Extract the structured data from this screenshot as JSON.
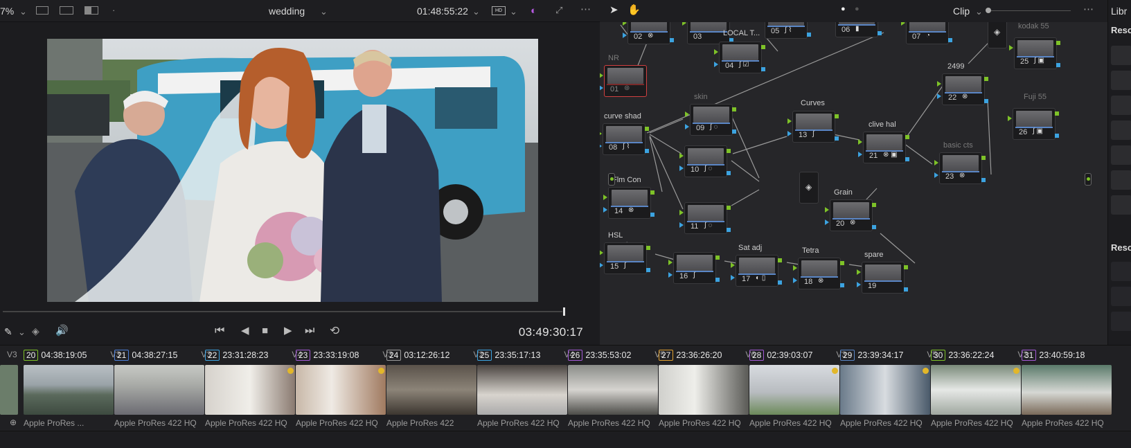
{
  "viewer": {
    "zoom": "7%",
    "clip_name": "wedding",
    "source_timecode": "01:48:55:22",
    "current_timecode": "03:49:30:17",
    "scrub_position": 0.95
  },
  "node_editor": {
    "mode_label": "Clip",
    "nodes": [
      {
        "num": "01",
        "label": "NR"
      },
      {
        "num": "02",
        "label": ""
      },
      {
        "num": "03",
        "label": ""
      },
      {
        "num": "04",
        "label": "LOCAL T..."
      },
      {
        "num": "05",
        "label": ""
      },
      {
        "num": "06",
        "label": ""
      },
      {
        "num": "07",
        "label": ""
      },
      {
        "num": "08",
        "label": "curve shad"
      },
      {
        "num": "09",
        "label": "skin"
      },
      {
        "num": "10",
        "label": ""
      },
      {
        "num": "11",
        "label": ""
      },
      {
        "num": "13",
        "label": "Curves"
      },
      {
        "num": "14",
        "label": "Flm Con"
      },
      {
        "num": "15",
        "label": "HSL"
      },
      {
        "num": "16",
        "label": ""
      },
      {
        "num": "17",
        "label": "Sat adj"
      },
      {
        "num": "18",
        "label": "Tetra"
      },
      {
        "num": "19",
        "label": "spare"
      },
      {
        "num": "20",
        "label": "Grain"
      },
      {
        "num": "21",
        "label": "clive hal"
      },
      {
        "num": "22",
        "label": "2499"
      },
      {
        "num": "23",
        "label": "basic cts"
      },
      {
        "num": "25",
        "label": "kodak 55"
      },
      {
        "num": "26",
        "label": "Fuji 55"
      }
    ]
  },
  "right_panel": {
    "tab_label": "Libr",
    "section1": "Reso",
    "section2": "Reso"
  },
  "clips": [
    {
      "num": "20",
      "timecode": "04:38:19:05",
      "track": "V3",
      "codec": "Apple ProRes ...",
      "flag": false
    },
    {
      "num": "21",
      "timecode": "04:38:27:15",
      "track": "V3",
      "codec": "Apple ProRes 422 HQ",
      "flag": false
    },
    {
      "num": "22",
      "timecode": "23:31:28:23",
      "track": "V4",
      "codec": "Apple ProRes 422 HQ",
      "flag": true
    },
    {
      "num": "23",
      "timecode": "23:33:19:08",
      "track": "V3",
      "codec": "Apple ProRes 422 HQ",
      "flag": true
    },
    {
      "num": "24",
      "timecode": "03:12:26:12",
      "track": "V2",
      "codec": "Apple ProRes 422",
      "flag": false
    },
    {
      "num": "25",
      "timecode": "23:35:17:13",
      "track": "V4",
      "codec": "Apple ProRes 422 HQ",
      "flag": false
    },
    {
      "num": "26",
      "timecode": "23:35:53:02",
      "track": "V5",
      "codec": "Apple ProRes 422 HQ",
      "flag": false
    },
    {
      "num": "27",
      "timecode": "23:36:26:20",
      "track": "V6",
      "codec": "Apple ProRes 422 HQ",
      "flag": false
    },
    {
      "num": "28",
      "timecode": "02:39:03:07",
      "track": "V3",
      "codec": "Apple ProRes 422 HQ",
      "flag": true
    },
    {
      "num": "29",
      "timecode": "23:39:34:17",
      "track": "V5",
      "codec": "Apple ProRes 422 HQ",
      "flag": true
    },
    {
      "num": "30",
      "timecode": "23:36:22:24",
      "track": "V2",
      "codec": "Apple ProRes 422 HQ",
      "flag": true
    },
    {
      "num": "31",
      "timecode": "23:40:59:18",
      "track": "",
      "codec": "Apple ProRes 422 HQ",
      "flag": false
    }
  ],
  "clip_badge_colors": [
    "#7ec228",
    "#4c7fd8",
    "#3ca3e0",
    "#a35ad6",
    "#9a9a9a",
    "#3ca3e0",
    "#a35ad6",
    "#e0a030",
    "#a35ad6",
    "#5a86c6",
    "#7ec228",
    "#a35ad6"
  ]
}
